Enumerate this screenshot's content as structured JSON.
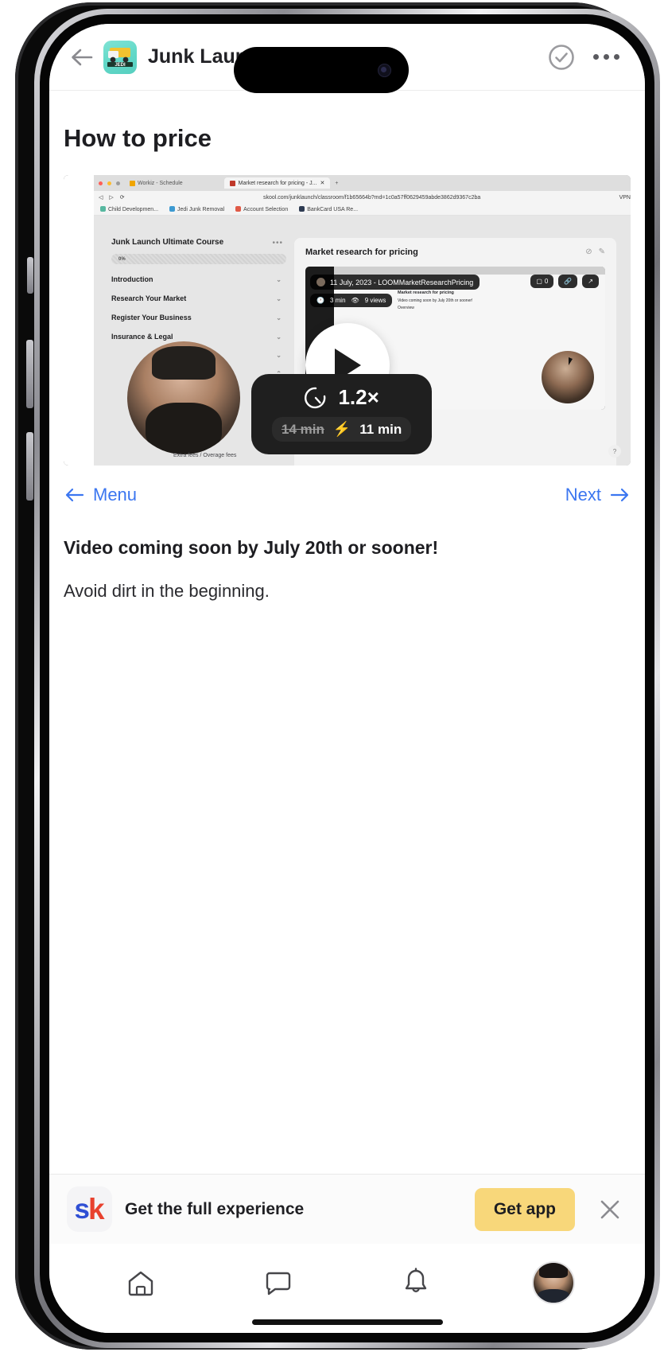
{
  "header": {
    "back_icon": "arrow-left-icon",
    "group_icon": "jedi-junk-removal-logo",
    "group_icon_text": "JEDI",
    "title": "Junk Laun",
    "check_icon": "check-circle-icon",
    "more_icon": "more-horizontal-icon"
  },
  "lesson": {
    "title": "How to price",
    "body_heading": "Video coming soon by July 20th or sooner!",
    "body_paragraph": "Avoid dirt in the beginning.",
    "nav": {
      "prev_label": "Menu",
      "prev_arrow": "←",
      "next_label": "Next",
      "next_arrow": "→"
    }
  },
  "video_card": {
    "play_icon": "play-icon",
    "speed_badge": {
      "gauge_icon": "speedometer-icon",
      "speed": "1.2×",
      "original_duration": "14 min",
      "bolt_icon": "lightning-bolt-icon",
      "new_duration": "11 min"
    },
    "browser": {
      "inactive_tab": "Workiz - Schedule",
      "active_tab": "Market research for pricing - J...",
      "new_tab": "+",
      "url": "skool.com/junklaunch/classroom/f1b65664b?md=1c0a57ff0629459abde3862d9367c2ba",
      "vpn_label": "VPN",
      "bookmarks": [
        "Child Developmen...",
        "Jedi Junk Removal",
        "Account Selection",
        "BankCard USA Re..."
      ],
      "course_name": "Junk Launch Ultimate Course",
      "course_menu_icon": "more-horizontal-icon",
      "course_progress": "0%",
      "course_sections": [
        "Introduction",
        "Research Your Market",
        "Register Your Business",
        "Insurance & Legal"
      ],
      "caption": "Extra fees / Overage fees",
      "lesson_panel_title": "Market research for pricing",
      "lesson_panel_icons": [
        "check-circle-icon",
        "pencil-icon"
      ],
      "loom": {
        "title": "11 July, 2023 - LOOMMarketResearchPricing",
        "duration": "3 min",
        "views": "9 views",
        "clock_icon": "clock-icon",
        "eye_icon": "eye-icon",
        "comment_count": "0",
        "comment_icon": "comment-icon",
        "link_icon": "link-icon",
        "share_icon": "share-icon",
        "doc_heading": "Market research for pricing",
        "doc_line1": "Video coming soon by July 20th or sooner!",
        "doc_line2": "Overview"
      },
      "help_icon": "help-icon"
    }
  },
  "app_banner": {
    "logo_s": "s",
    "logo_k": "k",
    "text": "Get the full experience",
    "button_label": "Get app",
    "close_icon": "close-icon"
  },
  "bottom_nav": {
    "items": [
      {
        "name": "home-icon"
      },
      {
        "name": "chat-icon"
      },
      {
        "name": "bell-icon"
      },
      {
        "name": "avatar"
      }
    ]
  },
  "colors": {
    "link_blue": "#3b76f0",
    "banner_yellow": "#f8d77a",
    "brand_teal": "#63d9c8",
    "bolt_yellow": "#f5b642"
  }
}
